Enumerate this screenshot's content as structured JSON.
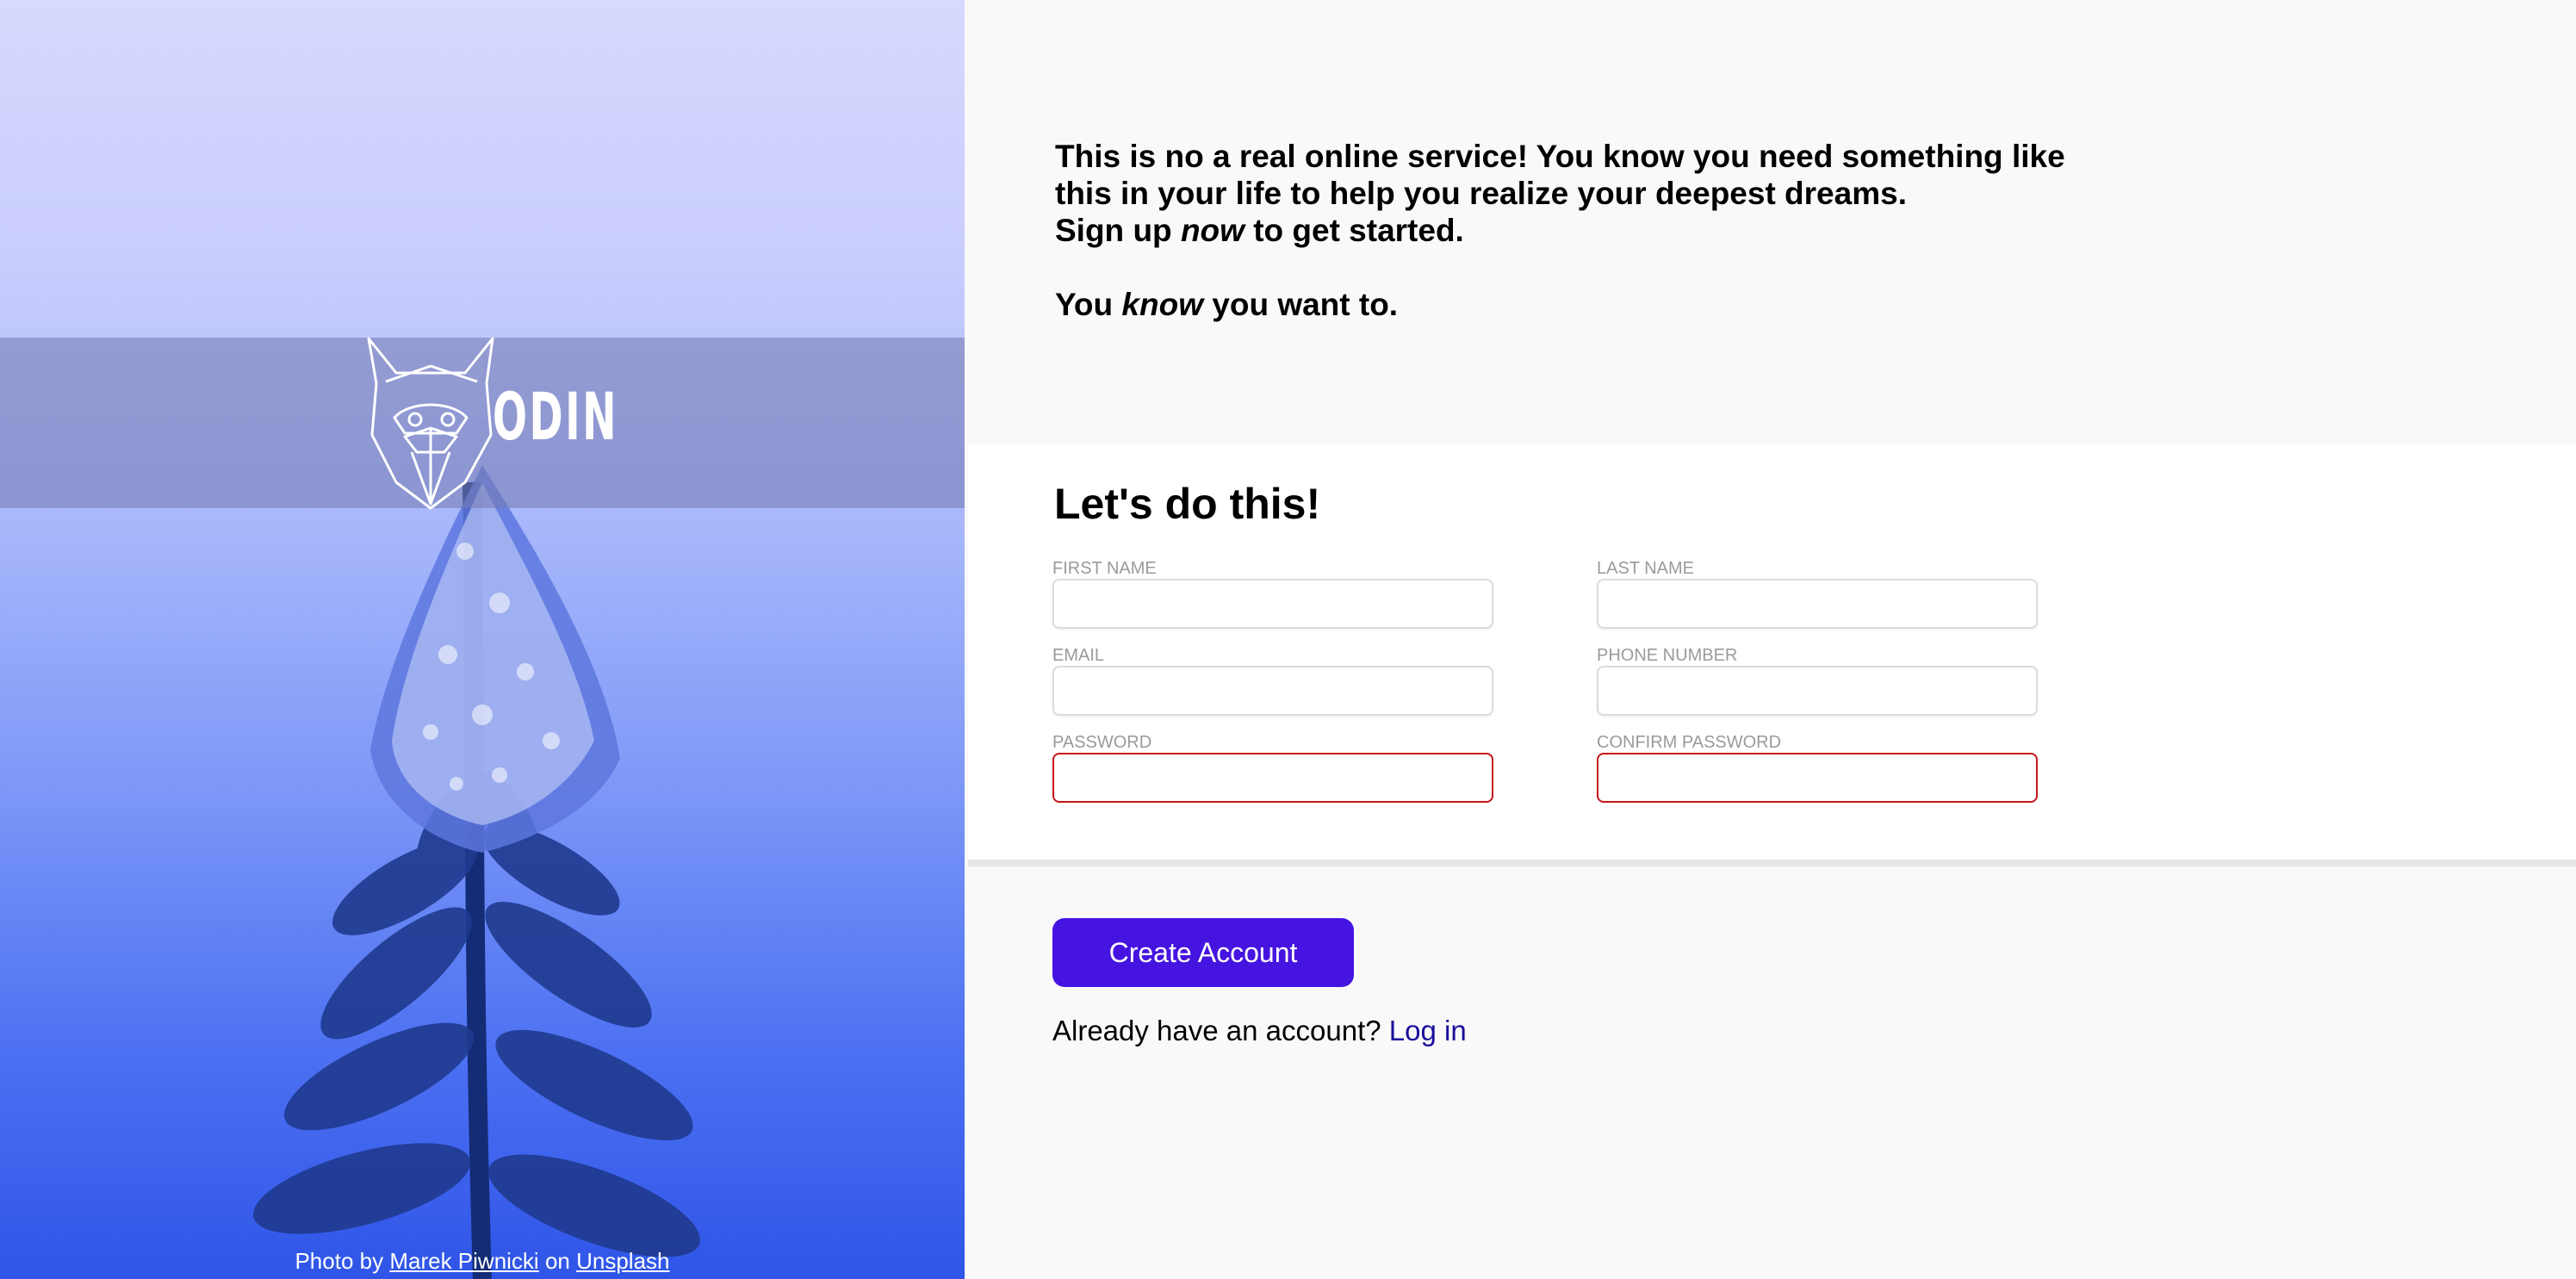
{
  "logo": {
    "text": "ODIN",
    "icon": "viking-head-icon"
  },
  "photo_credit": {
    "prefix": "Photo by",
    "author": "Marek Piwnicki",
    "middle": "on",
    "source": "Unsplash"
  },
  "intro": {
    "line1": "This is no a real online service! You know you need something like",
    "line2": "this in your life to help you realize your deepest dreams.",
    "line3_before": "Sign up ",
    "line3_em": "now",
    "line3_after": " to get started.",
    "line4_before": "You ",
    "line4_em": "know",
    "line4_after": " you want to."
  },
  "form": {
    "title": "Let's do this!",
    "fields": {
      "first_name": {
        "label": "FIRST NAME",
        "value": ""
      },
      "last_name": {
        "label": "LAST NAME",
        "value": ""
      },
      "email": {
        "label": "EMAIL",
        "value": ""
      },
      "phone": {
        "label": "PHONE NUMBER",
        "value": ""
      },
      "password": {
        "label": "PASSWORD",
        "value": "",
        "state": "invalid"
      },
      "confirm_password": {
        "label": "CONFIRM PASSWORD",
        "value": "",
        "state": "invalid"
      }
    }
  },
  "actions": {
    "create_label": "Create Account",
    "login_prompt": "Already have an account?",
    "login_link": "Log in"
  },
  "colors": {
    "accent": "#4614e0",
    "link": "#1a0d9c",
    "error": "#c6141a"
  }
}
